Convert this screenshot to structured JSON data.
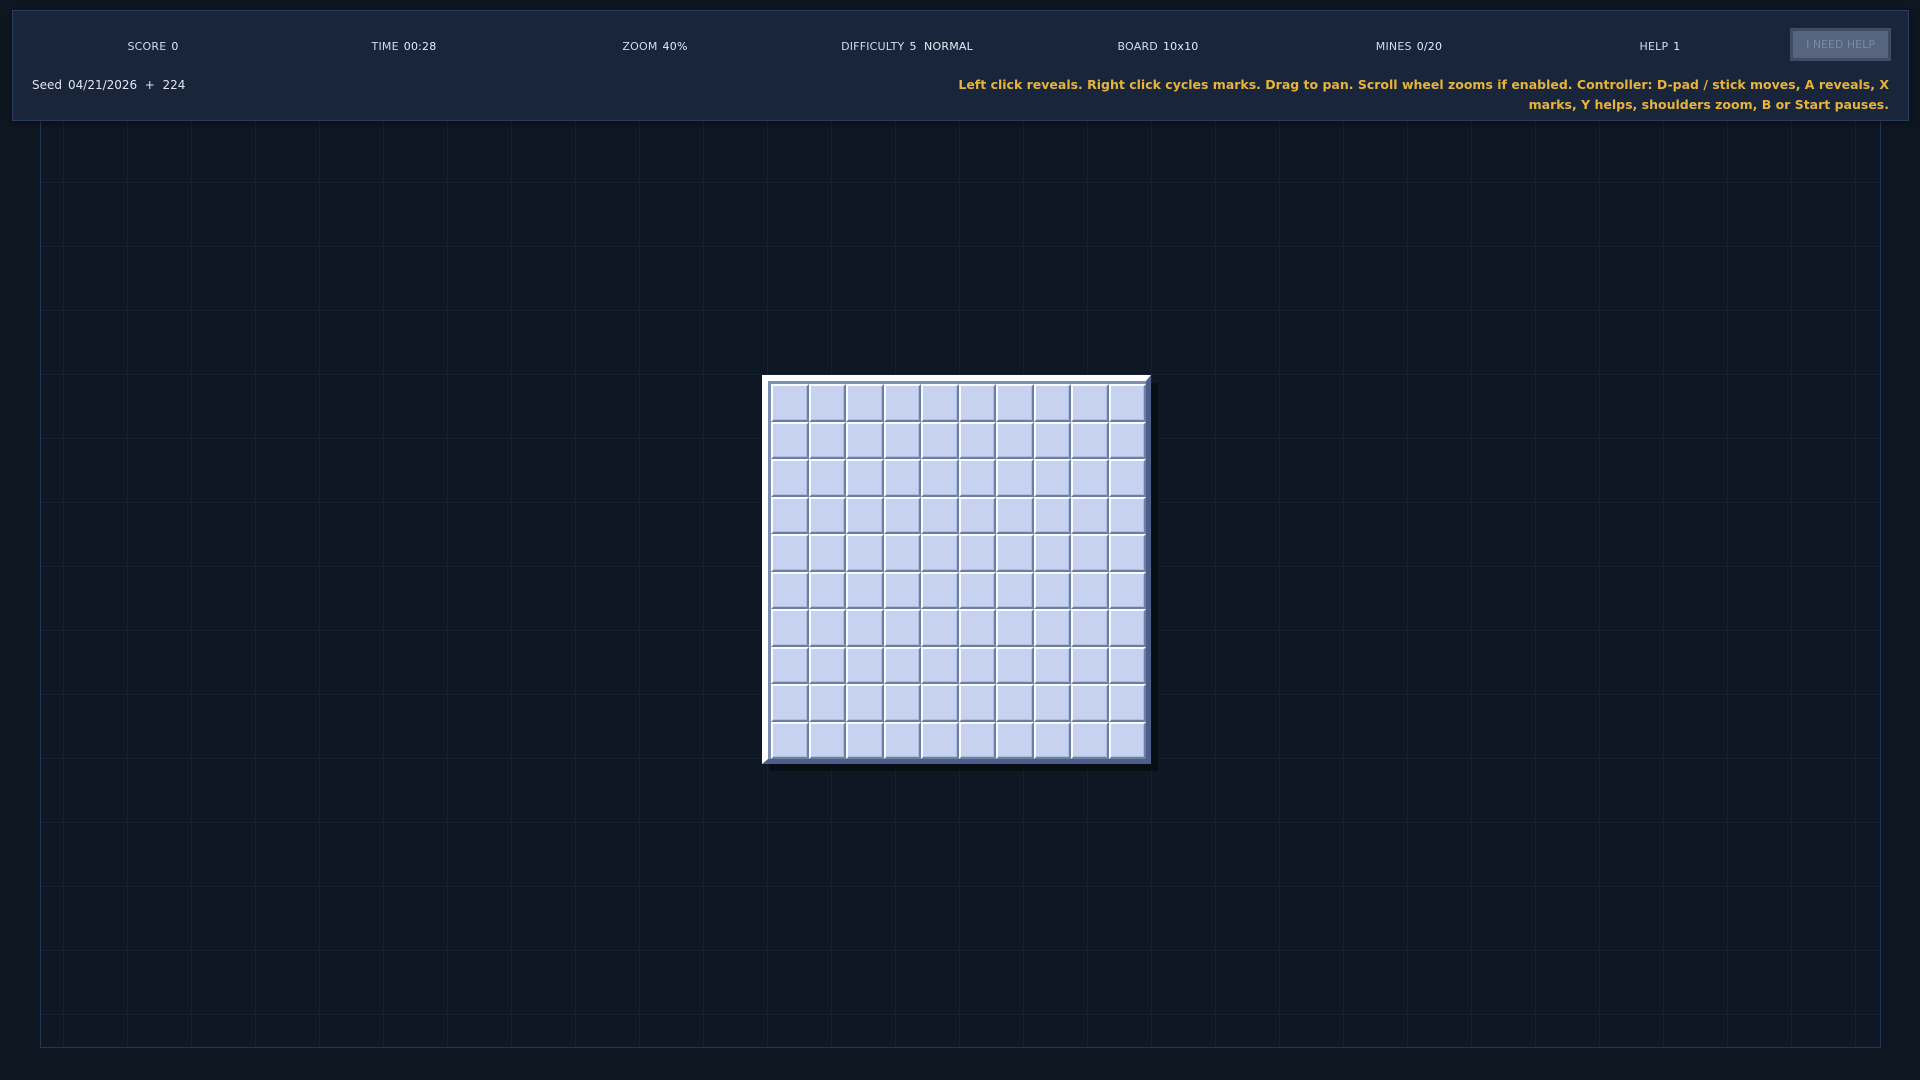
{
  "hud": {
    "stats": [
      {
        "label": "SCORE",
        "value": "0"
      },
      {
        "label": "TIME",
        "value": "00:28"
      },
      {
        "label": "ZOOM",
        "value": "40%"
      },
      {
        "label": "DIFFICULTY",
        "value": "5  NORMAL"
      },
      {
        "label": "BOARD",
        "value": "10x10"
      },
      {
        "label": "MINES",
        "value": "0/20"
      },
      {
        "label": "HELP",
        "value": "1"
      }
    ],
    "help_button_label": "I NEED HELP",
    "seed": {
      "label": "Seed",
      "value": "04/21/2026  +  224"
    },
    "instructions": "Left click reveals. Right click cycles marks. Drag to pan. Scroll wheel zooms if enabled. Controller: D-pad / stick moves, A reveals, X marks, Y helps, shoulders zoom, B or Start pauses."
  },
  "board": {
    "rows": 10,
    "cols": 10,
    "cell_state": "unrevealed"
  },
  "colors": {
    "background": "#0e1621",
    "hud": "#19253a",
    "instructions": "#e6b43c",
    "cell": "#c6d2ef"
  }
}
